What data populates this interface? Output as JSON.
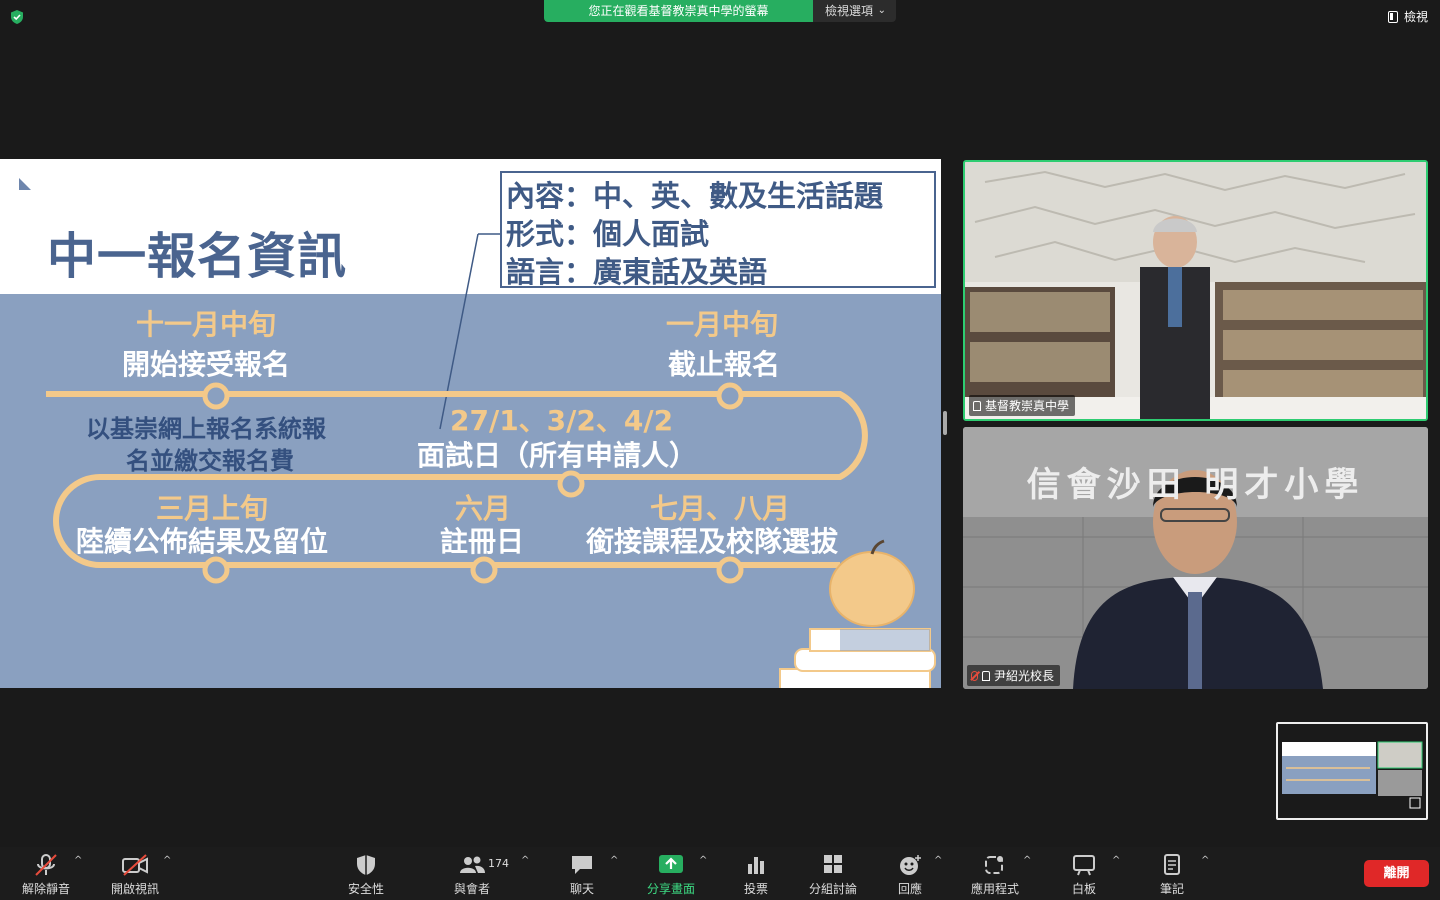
{
  "top_bar": {
    "share_banner": "您正在觀看基督教崇真中學的螢幕",
    "view_options": "檢視選項",
    "view_button": "檢視"
  },
  "slide": {
    "title": "中一報名資訊",
    "info_box": [
      "內容：中、英、數及生活話題",
      "形式：個人面試",
      "語言：廣東話及英語"
    ],
    "timeline": {
      "nov_date": "十一月中旬",
      "nov_event": "開始接受報名",
      "jan_date": "一月中旬",
      "jan_event": "截止報名",
      "online_line1": "以基崇網上報名系統報",
      "online_line2": "名並繳交報名費",
      "interview_dates": "27/1、3/2、4/2",
      "interview_event": "面試日（所有申請人）",
      "mar_date": "三月上旬",
      "mar_event": "陸續公佈結果及留位",
      "jun_date": "六月",
      "jun_event": "註冊日",
      "jul_date": "七月、八月",
      "jul_event": "銜接課程及校隊選拔"
    },
    "colors": {
      "background": "#8aa0c0",
      "title": "#4a648f",
      "timeline": "#f3c98a"
    }
  },
  "participants": [
    {
      "name": "基督教崇真中學",
      "pinned": true,
      "active_speaker": true
    },
    {
      "name": "尹紹光校長",
      "pinned": true,
      "muted": true,
      "background_sign": "信會沙田 明才小學"
    }
  ],
  "toolbar": {
    "mute": "解除靜音",
    "video": "開啟視訊",
    "security": "安全性",
    "participants": "與會者",
    "participants_count": "174",
    "chat": "聊天",
    "share": "分享畫面",
    "polls": "投票",
    "breakout": "分組討論",
    "reactions": "回應",
    "apps": "應用程式",
    "whiteboard": "白板",
    "notes": "筆記",
    "leave": "離開",
    "caret": "^",
    "chevron": "⌄"
  },
  "icons": {
    "shield": "shield-check-icon",
    "mic": "mic-off-icon",
    "camera": "video-off-icon",
    "security": "shield-icon",
    "participants": "people-icon",
    "chat": "chat-bubble-icon",
    "share": "share-arrow-icon",
    "polls": "bar-chart-icon",
    "breakout": "grid-icon",
    "reactions": "emoji-icon",
    "apps": "apps-icon",
    "whiteboard": "whiteboard-icon",
    "notes": "notes-icon"
  }
}
